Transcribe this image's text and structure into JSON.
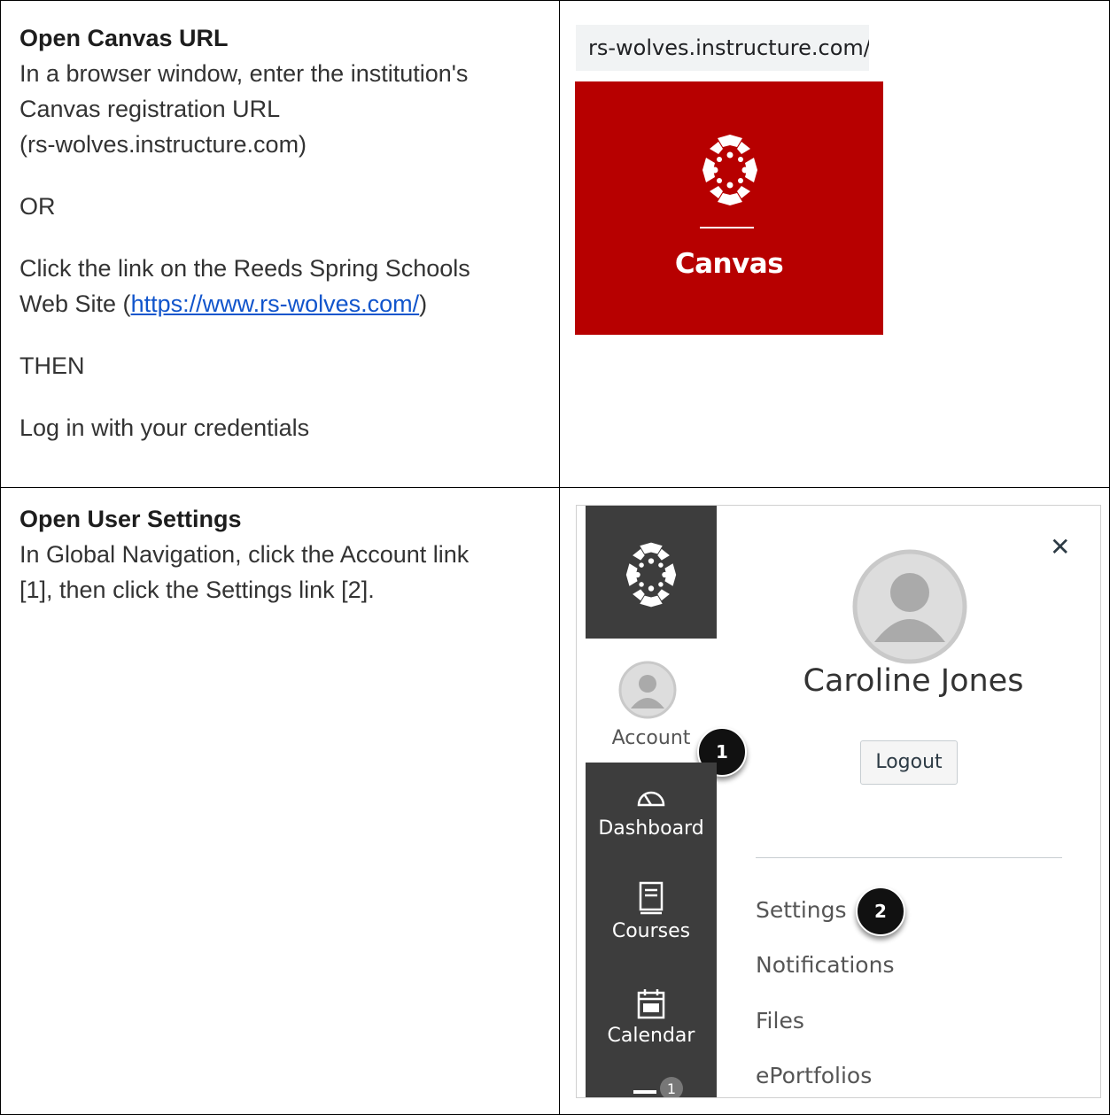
{
  "step1": {
    "title": "Open Canvas URL",
    "line1": "In a browser window, enter the institution's",
    "line2": "Canvas registration URL",
    "line3": "(rs-wolves.instructure.com)",
    "or": "OR",
    "click_line1": "Click the link on the Reeds Spring Schools",
    "click_prefix": "Web Site (",
    "link_text": "https://www.rs-wolves.com/",
    "click_suffix": ")",
    "then": "THEN",
    "login": "Log in with your credentials"
  },
  "url_bar": {
    "text": "rs-wolves.instructure.com/"
  },
  "canvas_logo": {
    "word": "Canvas",
    "color": "#b70000"
  },
  "step2": {
    "title": "Open User Settings",
    "line1": "In Global Navigation, click the Account link",
    "line2": "[1], then click the Settings link [2]."
  },
  "canvas_ui": {
    "nav_bg": "#3d3d3d",
    "account_label": "Account",
    "nav_items": [
      "Dashboard",
      "Courses",
      "Calendar"
    ],
    "inbox_badge": "1",
    "user_name": "Caroline Jones",
    "logout_label": "Logout",
    "menu": [
      "Settings",
      "Notifications",
      "Files",
      "ePortfolios"
    ],
    "callout_1": "1",
    "callout_2": "2"
  }
}
